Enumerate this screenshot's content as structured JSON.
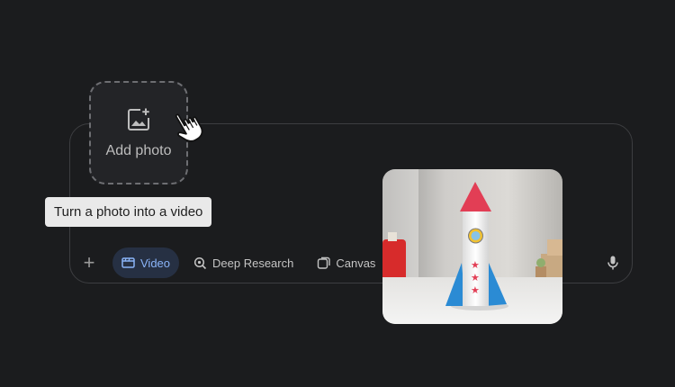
{
  "add_photo": {
    "label": "Add photo",
    "icon": "add-image-icon"
  },
  "tooltip": {
    "text": "Turn a photo into a video"
  },
  "toolbar": {
    "plus_icon": "plus-icon",
    "chips": [
      {
        "label": "Video",
        "icon": "film-icon",
        "active": true
      },
      {
        "label": "Deep Research",
        "icon": "deep-research-icon",
        "active": false
      },
      {
        "label": "Canvas",
        "icon": "canvas-icon",
        "active": false
      }
    ],
    "mic_icon": "microphone-icon"
  },
  "photo": {
    "subject": "paper rocket"
  },
  "colors": {
    "background": "#1b1c1e",
    "active_chip_bg": "#263043",
    "active_chip_text": "#8ab4f8",
    "tooltip_bg": "#e9e9e9"
  }
}
